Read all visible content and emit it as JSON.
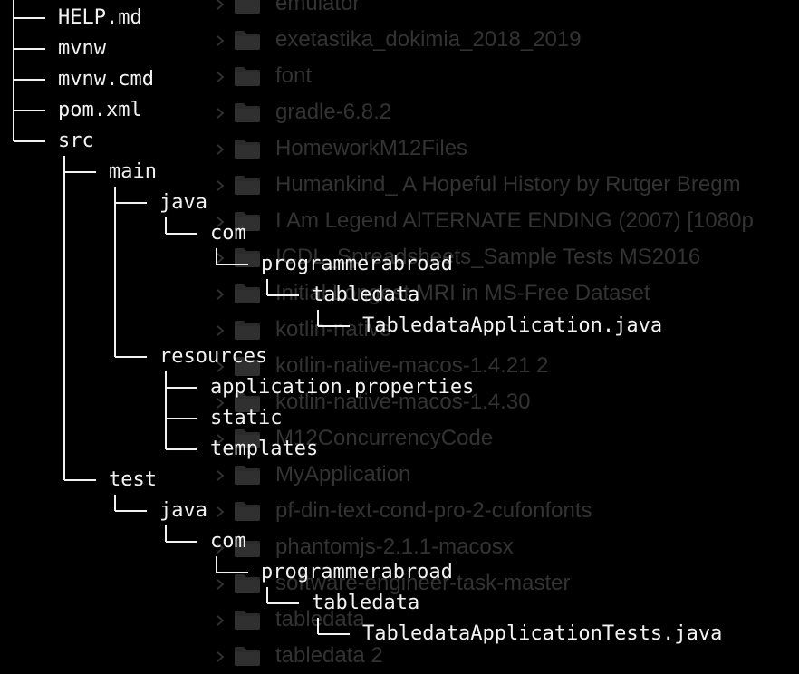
{
  "colors": {
    "background": "#000000",
    "tree_text": "#f2f2f2",
    "tree_lines": "#f2f2f2",
    "faded_text": "#333333",
    "folder": "#2a2a2a"
  },
  "finder": {
    "items": [
      {
        "name": "emulator",
        "icon": "folder-icon"
      },
      {
        "name": "exetastika_dokimia_2018_2019",
        "icon": "folder-icon"
      },
      {
        "name": "font",
        "icon": "folder-icon"
      },
      {
        "name": "gradle-6.8.2",
        "icon": "folder-icon"
      },
      {
        "name": "HomeworkM12Files",
        "icon": "folder-icon"
      },
      {
        "name": "Humankind_ A Hopeful History by Rutger Bregm",
        "icon": "folder-icon"
      },
      {
        "name": "I Am Legend AlTERNATE ENDING (2007) [1080p",
        "icon": "folder-icon"
      },
      {
        "name": "ICDL_Spreadsheets_Sample Tests MS2016",
        "icon": "folder-icon"
      },
      {
        "name": "Initial Longest MRI in MS-Free Dataset",
        "icon": "folder-icon"
      },
      {
        "name": "kotlin-native",
        "icon": "folder-icon"
      },
      {
        "name": "kotlin-native-macos-1.4.21 2",
        "icon": "folder-icon"
      },
      {
        "name": "kotlin-native-macos-1.4.30",
        "icon": "folder-icon"
      },
      {
        "name": "M12ConcurrencyCode",
        "icon": "folder-icon"
      },
      {
        "name": "MyApplication",
        "icon": "folder-icon"
      },
      {
        "name": "pf-din-text-cond-pro-2-cufonfonts",
        "icon": "folder-icon"
      },
      {
        "name": "phantomjs-2.1.1-macosx",
        "icon": "folder-icon"
      },
      {
        "name": "software-engineer-task-master",
        "icon": "folder-icon"
      },
      {
        "name": "tabledata",
        "icon": "folder-icon"
      },
      {
        "name": "tabledata 2",
        "icon": "folder-icon"
      }
    ]
  },
  "tree": {
    "nodes": [
      {
        "label": "HELP.md",
        "depth": 0,
        "last": false
      },
      {
        "label": "mvnw",
        "depth": 0,
        "last": false
      },
      {
        "label": "mvnw.cmd",
        "depth": 0,
        "last": false
      },
      {
        "label": "pom.xml",
        "depth": 0,
        "last": false
      },
      {
        "label": "src",
        "depth": 0,
        "last": true
      },
      {
        "label": "main",
        "depth": 1,
        "last": false
      },
      {
        "label": "java",
        "depth": 2,
        "last": false
      },
      {
        "label": "com",
        "depth": 3,
        "last": true
      },
      {
        "label": "programmerabroad",
        "depth": 4,
        "last": true
      },
      {
        "label": "tabledata",
        "depth": 5,
        "last": true
      },
      {
        "label": "TabledataApplication.java",
        "depth": 6,
        "last": true
      },
      {
        "label": "resources",
        "depth": 2,
        "last": true
      },
      {
        "label": "application.properties",
        "depth": 3,
        "last": false
      },
      {
        "label": "static",
        "depth": 3,
        "last": false
      },
      {
        "label": "templates",
        "depth": 3,
        "last": true
      },
      {
        "label": "test",
        "depth": 1,
        "last": true
      },
      {
        "label": "java",
        "depth": 2,
        "last": true
      },
      {
        "label": "com",
        "depth": 3,
        "last": true
      },
      {
        "label": "programmerabroad",
        "depth": 4,
        "last": true
      },
      {
        "label": "tabledata",
        "depth": 5,
        "last": true
      },
      {
        "label": "TabledataApplicationTests.java",
        "depth": 6,
        "last": true
      }
    ]
  }
}
